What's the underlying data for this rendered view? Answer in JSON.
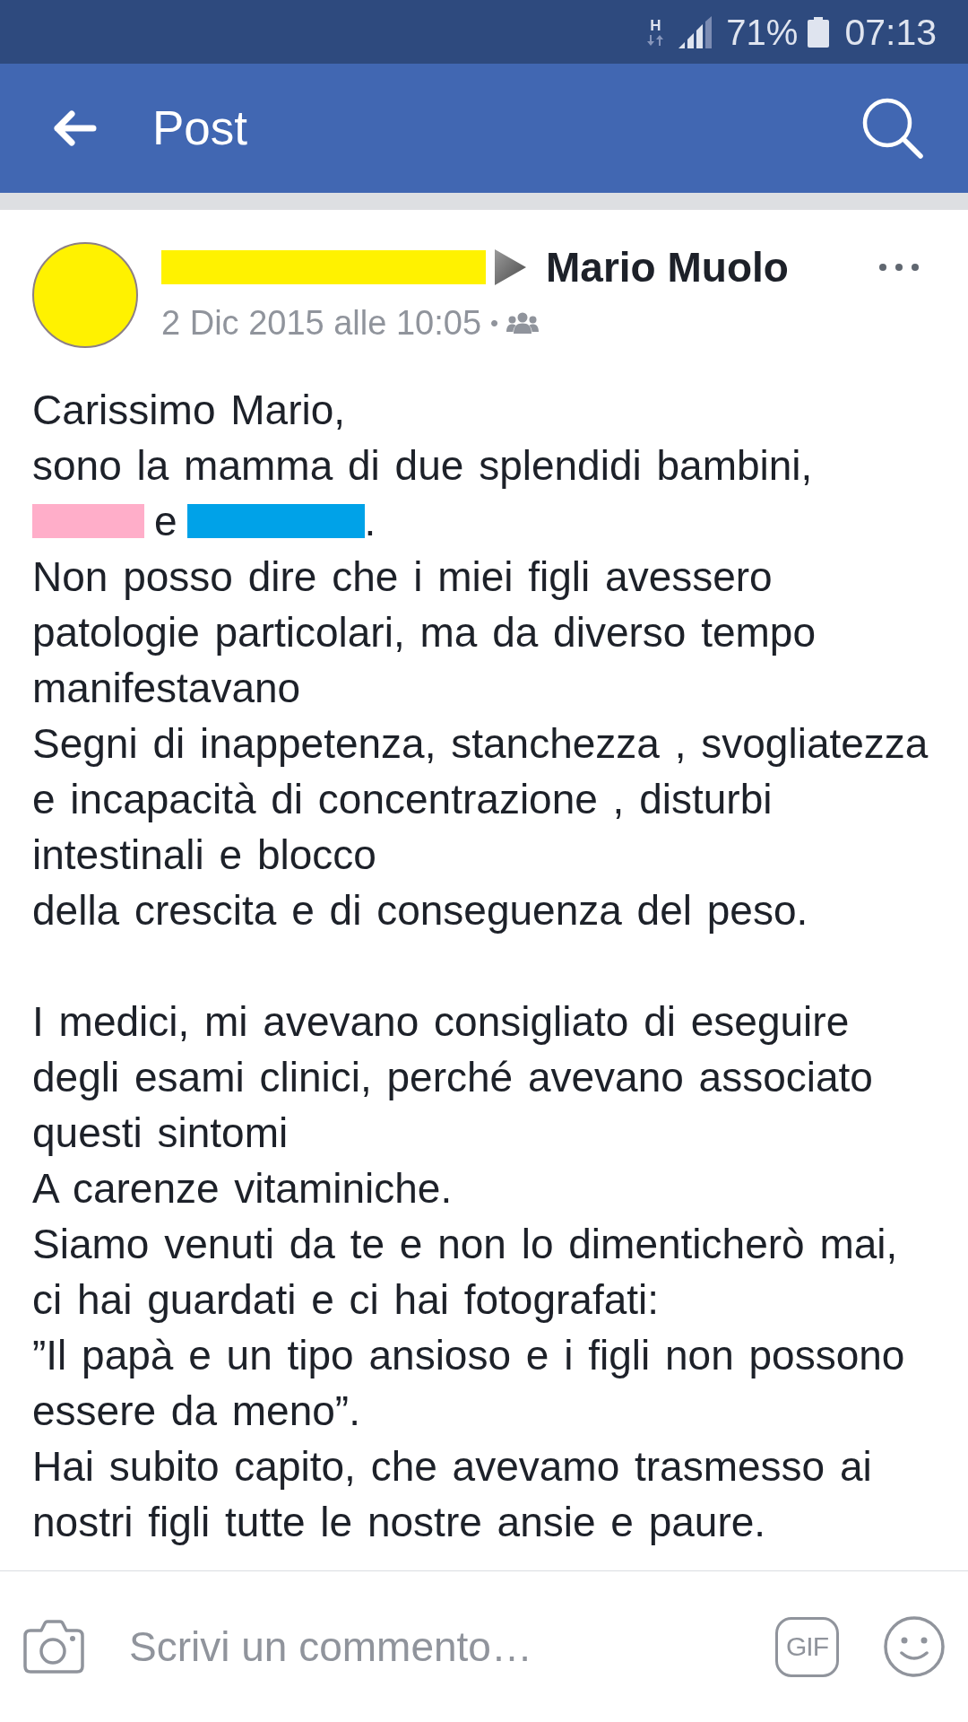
{
  "status_bar": {
    "network_type": "H",
    "battery_percent": "71%",
    "time": "07:13"
  },
  "app_bar": {
    "title": "Post"
  },
  "post": {
    "recipient": "Mario Muolo",
    "timestamp": "2 Dic 2015 alle 10:05",
    "separator": "•",
    "body": [
      {
        "kind": "text",
        "text": "Carissimo Mario,"
      },
      {
        "kind": "text",
        "text": "sono la mamma di due splendidi bambini,"
      },
      {
        "kind": "segments",
        "segments": [
          {
            "kind": "redaction",
            "color": "#ffaec9"
          },
          {
            "kind": "text",
            "text": "e"
          },
          {
            "kind": "redaction",
            "color": "#00a2e8"
          },
          {
            "kind": "text",
            "text": "."
          }
        ]
      },
      {
        "kind": "text",
        "text": "Non posso dire che i miei figli avessero patologie particolari, ma da diverso tempo manifestavano"
      },
      {
        "kind": "text",
        "text": "Segni di inappetenza, stanchezza , svogliatezza e incapacità di concentrazione , disturbi intestinali e blocco"
      },
      {
        "kind": "text",
        "text": "della crescita e di conseguenza del peso."
      },
      {
        "kind": "blank"
      },
      {
        "kind": "text",
        "text": "I medici, mi avevano consigliato di eseguire degli esami clinici, perché avevano associato questi sintomi"
      },
      {
        "kind": "text",
        "text": "A carenze vitaminiche."
      },
      {
        "kind": "text",
        "text": "Siamo venuti da te e non lo dimenticherò mai, ci hai guardati e ci hai fotografati:"
      },
      {
        "kind": "text",
        "text": "”Il papà e un tipo ansioso e i figli non possono essere da meno”."
      },
      {
        "kind": "text",
        "text": "Hai subito capito, che avevamo trasmesso ai nostri figli tutte le nostre ansie e paure."
      }
    ]
  },
  "comment_bar": {
    "placeholder": "Scrivi un commento…",
    "gif_label": "GIF"
  }
}
